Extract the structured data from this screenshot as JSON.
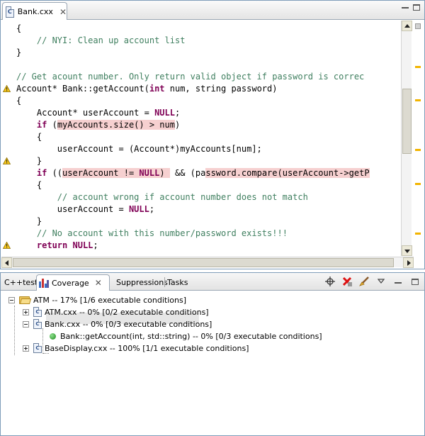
{
  "editor": {
    "tab_label": "Bank.cxx",
    "tab_file_icon": "C",
    "code_lines": [
      [
        {
          "t": "{"
        }
      ],
      [
        {
          "t": "    "
        },
        {
          "t": "// NYI: Clean up account list",
          "c": "cm"
        }
      ],
      [
        {
          "t": "}"
        }
      ],
      [
        {
          "t": ""
        }
      ],
      [
        {
          "t": "// Get acount number. Only return valid object if password is correc",
          "c": "cm"
        }
      ],
      [
        {
          "t": "Account* Bank::getAccount("
        },
        {
          "t": "int",
          "c": "kw"
        },
        {
          "t": " num, string password)"
        }
      ],
      [
        {
          "t": "{"
        }
      ],
      [
        {
          "t": "    Account* userAccount = "
        },
        {
          "t": "NULL",
          "c": "kw"
        },
        {
          "t": ";"
        }
      ],
      [
        {
          "t": "    "
        },
        {
          "t": "if",
          "c": "kw"
        },
        {
          "t": " ("
        },
        {
          "t": "myAccounts.size() > num",
          "c": "hl"
        },
        {
          "t": ")"
        }
      ],
      [
        {
          "t": "    {"
        }
      ],
      [
        {
          "t": "        userAccount = (Account*)myAccounts[num];"
        }
      ],
      [
        {
          "t": "    }"
        }
      ],
      [
        {
          "t": "    "
        },
        {
          "t": "if",
          "c": "kw"
        },
        {
          "t": " (("
        },
        {
          "t": "userAccount != ",
          "c": "hl"
        },
        {
          "t": "NULL",
          "c": "kw hl"
        },
        {
          "t": ") ",
          "c": "hl"
        },
        {
          "t": " && (pa"
        },
        {
          "t": "ssword.compare(userAccount->getP",
          "c": "hl"
        }
      ],
      [
        {
          "t": "    {"
        }
      ],
      [
        {
          "t": "        "
        },
        {
          "t": "// account wrong if account number does not match",
          "c": "cm"
        }
      ],
      [
        {
          "t": "        userAccount = "
        },
        {
          "t": "NULL",
          "c": "kw"
        },
        {
          "t": ";"
        }
      ],
      [
        {
          "t": "    }"
        }
      ],
      [
        {
          "t": "    "
        },
        {
          "t": "// No account with this number/password exists!!!",
          "c": "cm"
        }
      ],
      [
        {
          "t": "    "
        },
        {
          "t": "return",
          "c": "kw"
        },
        {
          "t": " "
        },
        {
          "t": "NULL",
          "c": "kw"
        },
        {
          "t": ";"
        }
      ]
    ],
    "warning_lines": [
      6,
      12,
      19
    ],
    "overview_marks": [
      2,
      4,
      7,
      9,
      12,
      15
    ]
  },
  "views": {
    "tabs": [
      "C++test",
      "Coverage",
      "Suppressions",
      "Tasks"
    ],
    "active_tab": "Coverage",
    "toolbar_icons": [
      "target-icon",
      "delete-red-icon",
      "brush-icon",
      "view-menu-icon",
      "minimize-icon",
      "maximize-icon"
    ]
  },
  "coverage_tree": {
    "root": "ATM -- 17% [1/6 executable conditions]",
    "atm_file": "ATM.cxx -- 0% [0/2 executable conditions]",
    "bank_file": "Bank.cxx -- 0% [0/3 executable conditions]",
    "bank_method": "Bank::getAccount(int, std::string) -- 0% [0/3 executable conditions]",
    "display_file": "BaseDisplay.cxx -- 100% [1/1 executable conditions]",
    "file_icon_letter": "C"
  }
}
